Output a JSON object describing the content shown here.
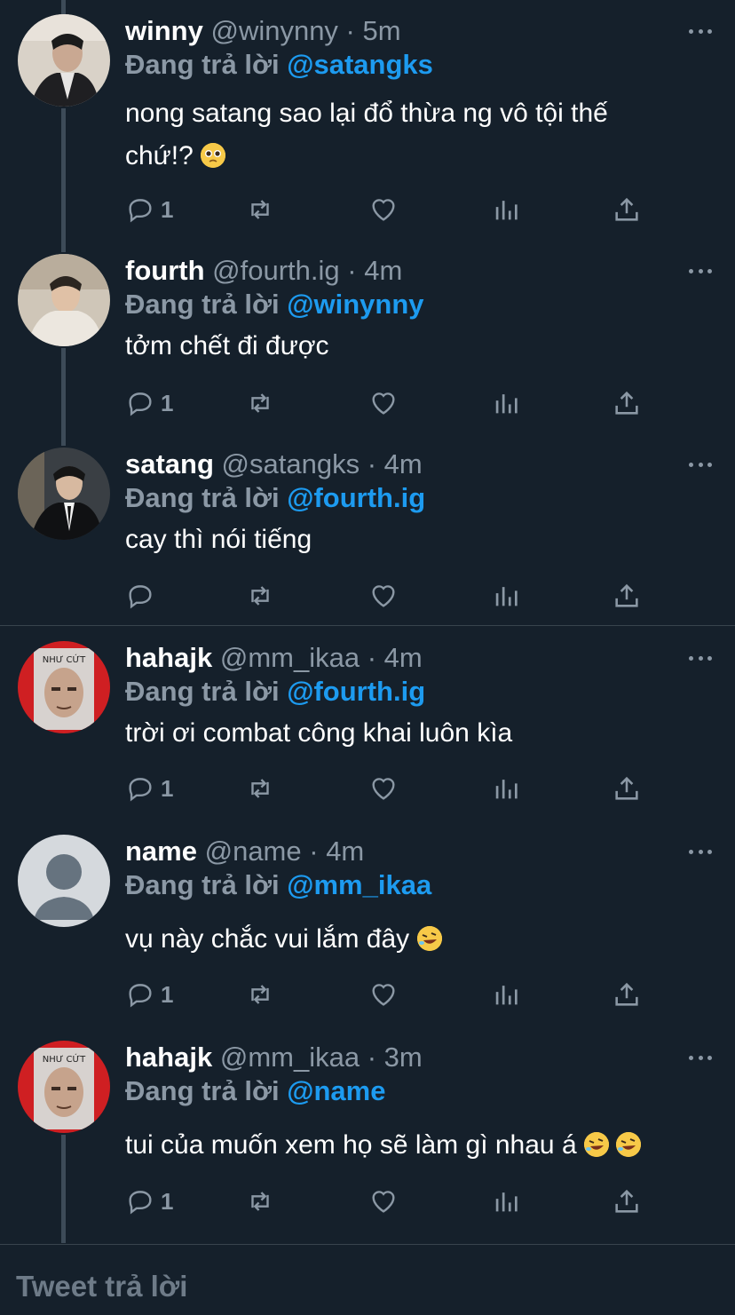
{
  "replying_label": "Đang trả lời",
  "tweets": [
    {
      "name": "winny",
      "handle": "@winynny",
      "time": "5m",
      "mention": "@satangks",
      "text_line1": "nong satang sao lại đổ thừa ng vô tội thế",
      "text_line2": "chứ!?",
      "emoji": "pleading-face",
      "replies": "1"
    },
    {
      "name": "fourth",
      "handle": "@fourth.ig",
      "time": "4m",
      "mention": "@winynny",
      "text_line1": "tởm chết đi được",
      "replies": "1"
    },
    {
      "name": "satang",
      "handle": "@satangks",
      "time": "4m",
      "mention": "@fourth.ig",
      "text_line1": "cay thì nói tiếng",
      "replies": ""
    },
    {
      "name": "hahajk",
      "handle": "@mm_ikaa",
      "time": "4m",
      "mention": "@fourth.ig",
      "text_line1": "trời ơi combat công khai luôn kìa",
      "replies": "1",
      "avatar_text": "NHƯ CỨT"
    },
    {
      "name": "name",
      "handle": "@name",
      "time": "4m",
      "mention": "@mm_ikaa",
      "text_line1": "vụ này chắc vui lắm đây",
      "emoji": "rofl",
      "replies": "1"
    },
    {
      "name": "hahajk",
      "handle": "@mm_ikaa",
      "time": "3m",
      "mention": "@name",
      "text_line1": "tui của muốn xem họ sẽ làm gì nhau á",
      "emoji": "rofl rofl",
      "replies": "1",
      "avatar_text": "NHƯ CỨT"
    }
  ],
  "reply_placeholder": "Tweet trả lời",
  "colors": {
    "background": "#15202b",
    "accent": "#1d9bf0",
    "secondary": "#8b98a5"
  },
  "icons": [
    "reply-icon",
    "retweet-icon",
    "like-icon",
    "analytics-icon",
    "share-icon",
    "more-icon"
  ]
}
